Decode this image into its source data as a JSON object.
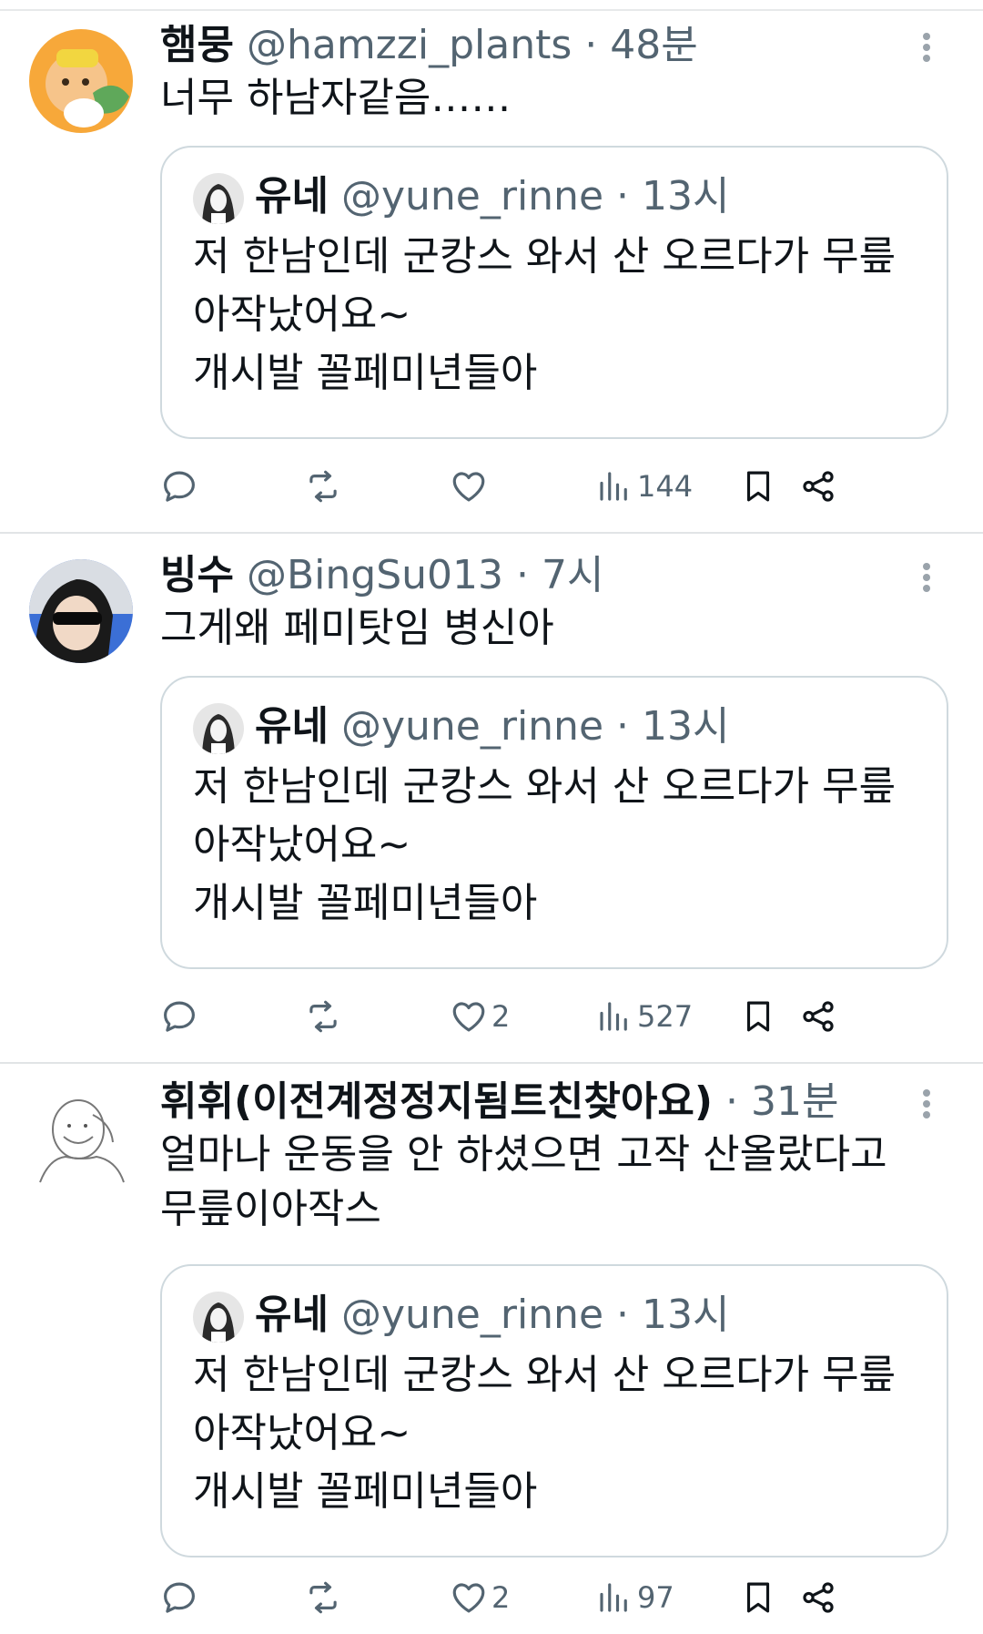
{
  "tweets": [
    {
      "name": "햄뭉",
      "handle": "@hamzzi_plants",
      "dot": "·",
      "time": "48분",
      "text": "너무 하남자같음……",
      "quote": {
        "name": "유네",
        "handle": "@yune_rinne",
        "dot": "·",
        "time": "13시",
        "text": "저 한남인데 군캉스 와서 산 오르다가 무릎\n아작났어요~\n개시발 꼴페미년들아"
      },
      "actions": {
        "reply": "",
        "retweet": "",
        "like": "",
        "views": "144"
      }
    },
    {
      "name": "빙수",
      "handle": "@BingSu013",
      "dot": "·",
      "time": "7시",
      "text": "그게왜 페미탓임 병신아",
      "quote": {
        "name": "유네",
        "handle": "@yune_rinne",
        "dot": "·",
        "time": "13시",
        "text": "저 한남인데 군캉스 와서 산 오르다가 무릎\n아작났어요~\n개시발 꼴페미년들아"
      },
      "actions": {
        "reply": "",
        "retweet": "",
        "like": "2",
        "views": "527"
      }
    },
    {
      "name": "휘휘(이전계정정지됨트친찾아요)",
      "handle": "",
      "dot": "·",
      "time": "31분",
      "text": "얼마나 운동을 안 하셨으면 고작 산올랐다고\n무릎이아작스",
      "quote": {
        "name": "유네",
        "handle": "@yune_rinne",
        "dot": "·",
        "time": "13시",
        "text": "저 한남인데 군캉스 와서 산 오르다가 무릎\n아작났어요~\n개시발 꼴페미년들아"
      },
      "actions": {
        "reply": "",
        "retweet": "",
        "like": "2",
        "views": "97"
      }
    }
  ],
  "icons": {
    "reply": "reply-icon",
    "retweet": "retweet-icon",
    "like": "heart-icon",
    "views": "views-icon",
    "bookmark": "bookmark-icon",
    "share": "share-icon",
    "more": "more-dots-icon"
  },
  "colors": {
    "text": "#0f1419",
    "secondary": "#536471",
    "border": "#cfd9de"
  }
}
